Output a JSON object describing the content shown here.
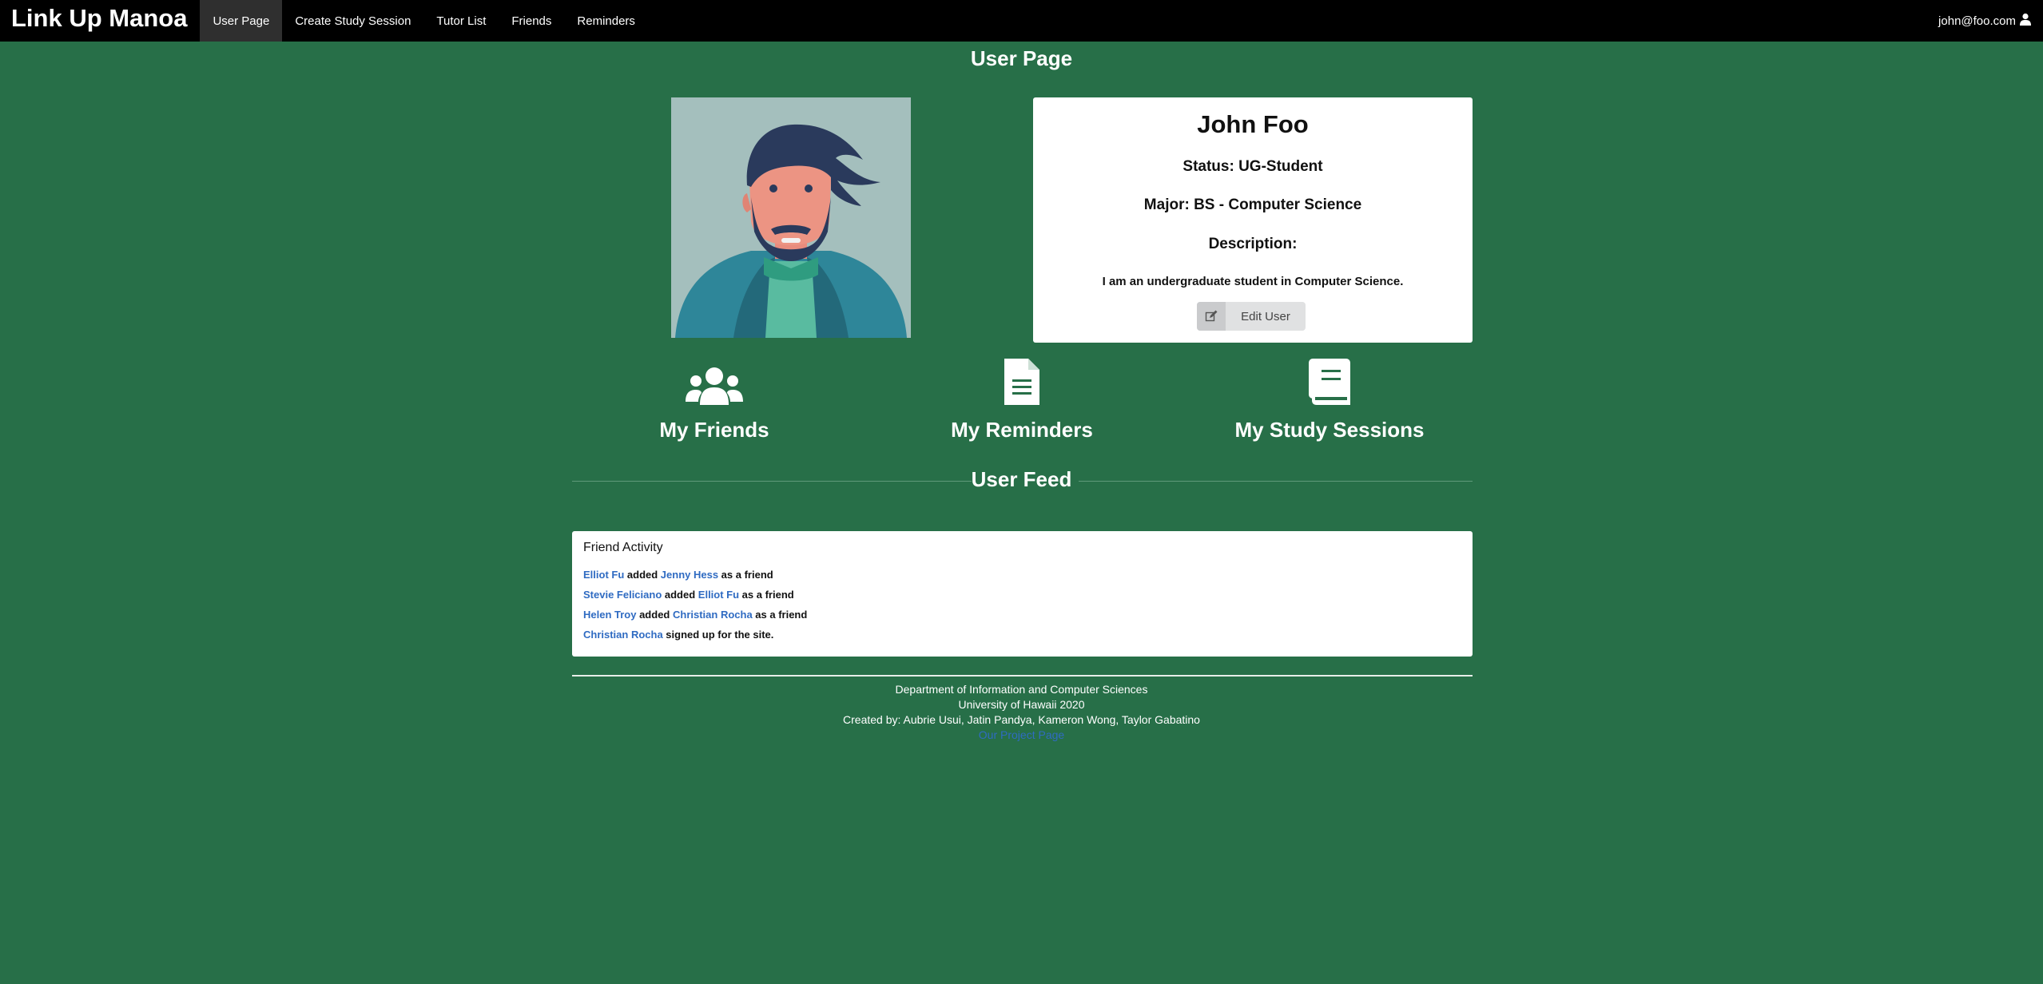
{
  "nav": {
    "brand": "Link Up Manoa",
    "items": [
      {
        "label": "User Page",
        "active": true
      },
      {
        "label": "Create Study Session"
      },
      {
        "label": "Tutor List"
      },
      {
        "label": "Friends"
      },
      {
        "label": "Reminders"
      }
    ],
    "user_email": "john@foo.com",
    "user_icon": "user-icon"
  },
  "page": {
    "title": "User Page"
  },
  "profile": {
    "avatar_icon": "avatar-illustration",
    "name": "John Foo",
    "status": "Status: UG-Student",
    "major": "Major: BS - Computer Science",
    "description_label": "Description:",
    "description": "I am an undergraduate student in Computer Science.",
    "edit_button": "Edit User",
    "edit_icon": "edit-icon"
  },
  "features": [
    {
      "label": "My Friends",
      "icon": "users-icon"
    },
    {
      "label": "My Reminders",
      "icon": "file-icon"
    },
    {
      "label": "My Study Sessions",
      "icon": "book-icon"
    }
  ],
  "feed": {
    "title": "User Feed",
    "card_title": "Friend Activity",
    "rows": [
      {
        "a": "Elliot Fu",
        "verb": " added ",
        "b": "Jenny Hess",
        "tail": " as a friend"
      },
      {
        "a": "Stevie Feliciano",
        "verb": " added ",
        "b": "Elliot Fu",
        "tail": " as a friend"
      },
      {
        "a": "Helen Troy",
        "verb": " added ",
        "b": "Christian Rocha",
        "tail": " as a friend"
      },
      {
        "a": "Christian Rocha",
        "tail": " signed up for the site."
      }
    ]
  },
  "footer": {
    "line1": "Department of Information and Computer Sciences",
    "line2": "University of Hawaii 2020",
    "line3": "Created by: Aubrie Usui, Jatin Pandya, Kameron Wong, Taylor Gabatino",
    "link": "Our Project Page"
  },
  "colors": {
    "background": "#276f48",
    "navbar": "#000000",
    "link": "#2f6bc2"
  }
}
